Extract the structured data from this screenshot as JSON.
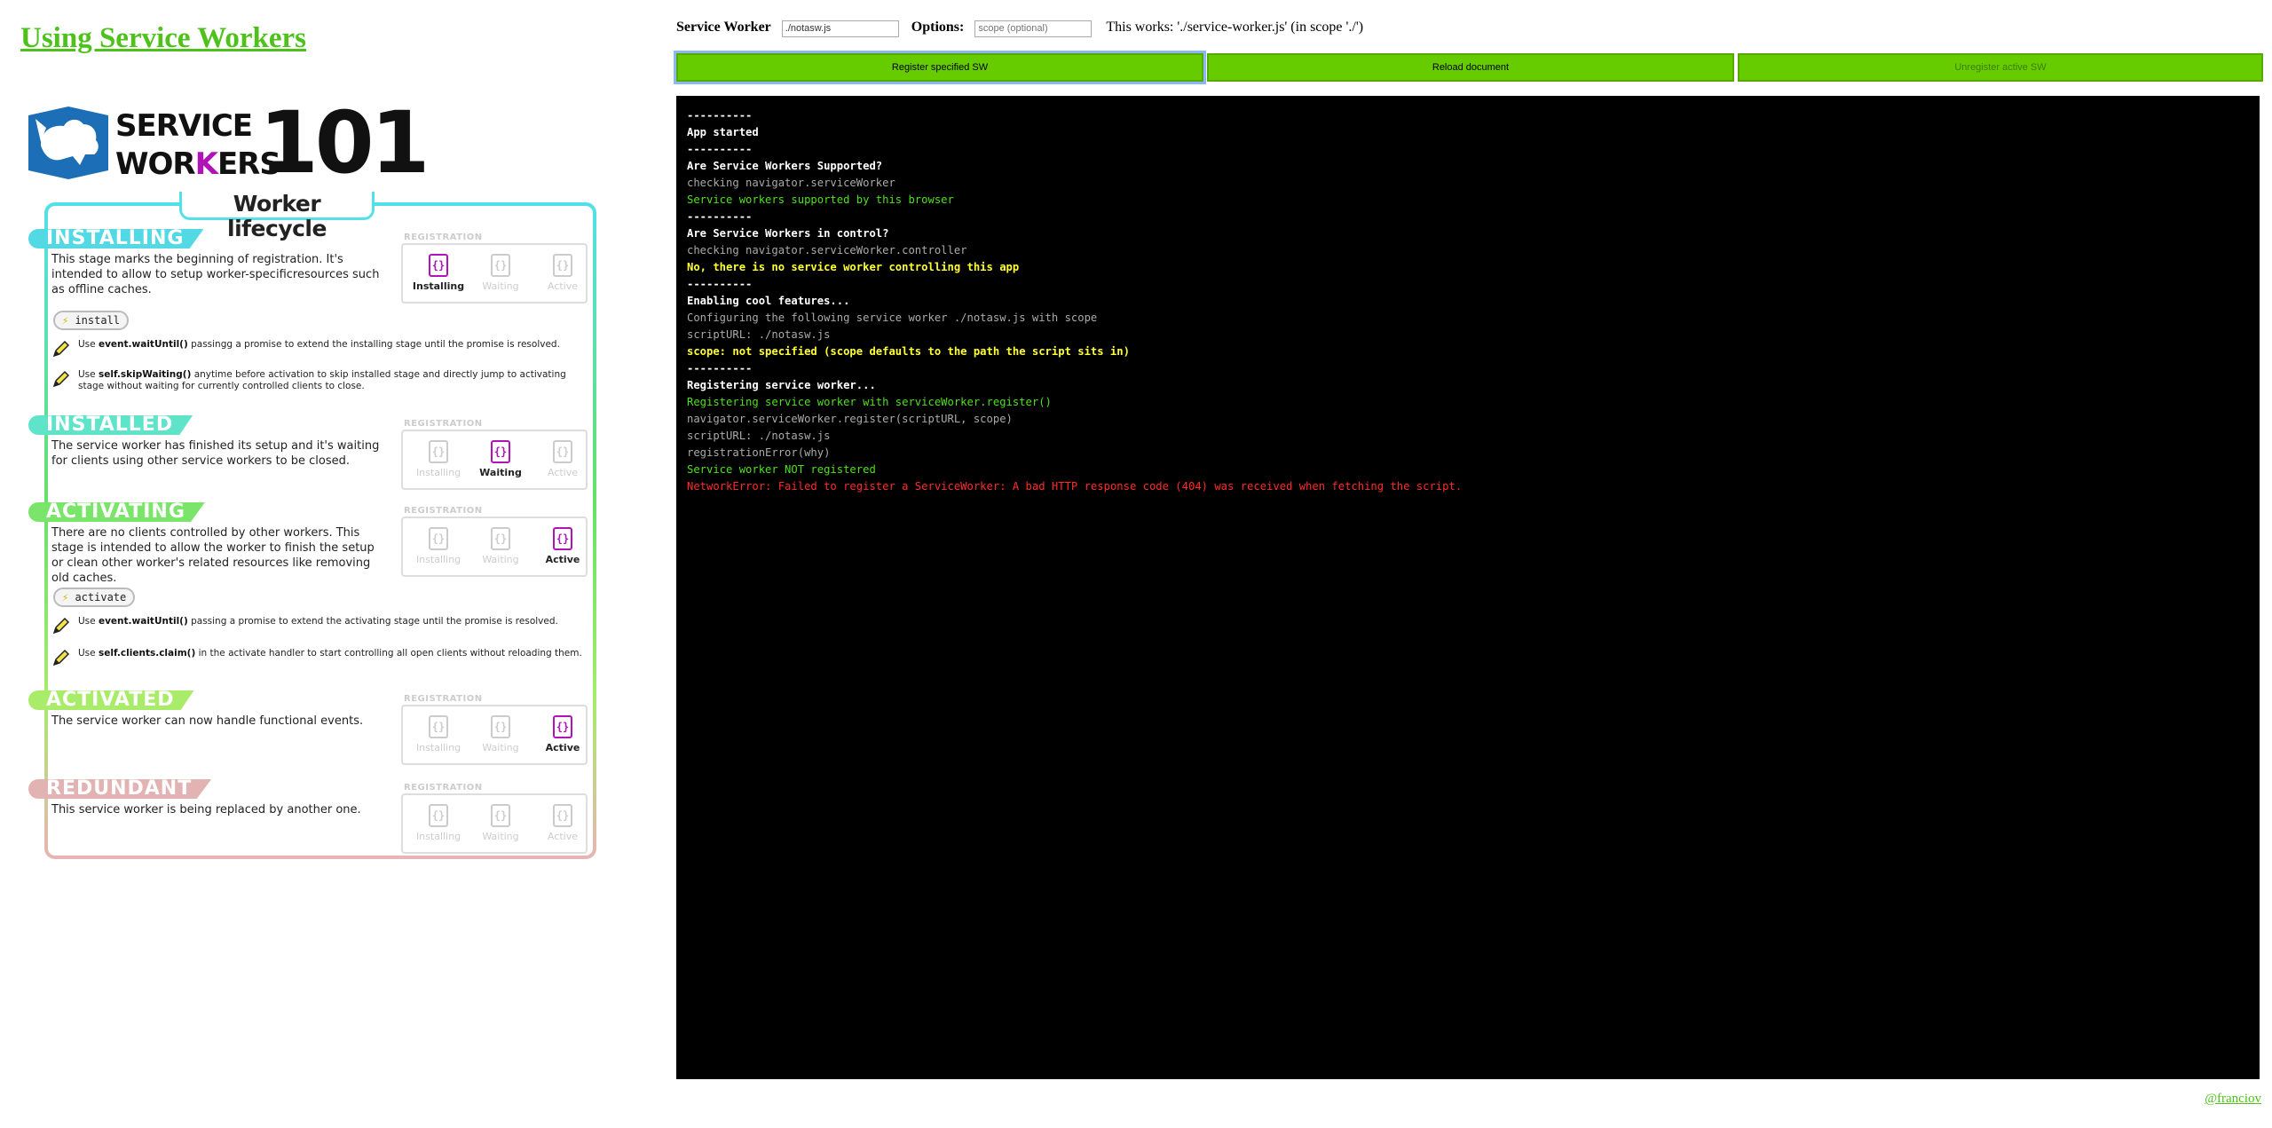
{
  "title": "Using Service Workers",
  "logo": {
    "word1": "SERVICE",
    "word2a": "WOR",
    "word2k": "K",
    "word2b": "ERS",
    "number": "101"
  },
  "lifecycle": {
    "heading": "Worker lifecycle",
    "registration_label": "REGISTRATION",
    "states": [
      "Installing",
      "Waiting",
      "Active"
    ],
    "sections": [
      {
        "badge": "INSTALLING",
        "color": "#52d9e4",
        "desc": "This stage marks the beginning of registration. It's intended to allow to setup worker-specificresources such as offline caches.",
        "active_state": 0,
        "event": "install",
        "tips": [
          {
            "code": "event.waitUntil()",
            "rest": " passingg a promise to extend the installing stage until the promise is resolved."
          },
          {
            "code": "self.skipWaiting()",
            "rest": " anytime before activation to skip installed stage and directly jump to activating stage without waiting for currently controlled clients to close."
          }
        ]
      },
      {
        "badge": "INSTALLED",
        "color": "#5fe3c9",
        "desc": "The service worker has finished its setup and it's waiting for clients using other service workers to be closed.",
        "active_state": 1
      },
      {
        "badge": "ACTIVATING",
        "color": "#7be46a",
        "desc": "There are no clients controlled by other workers. This stage is intended to allow the worker to finish the setup or clean other worker's related resources like removing old caches.",
        "active_state": 2,
        "event": "activate",
        "tips": [
          {
            "code": "event.waitUntil()",
            "rest": " passing a promise to extend the activating stage until the promise is resolved."
          },
          {
            "code": "self.clients.claim()",
            "rest": "  in the activate handler to start controlling all open clients without reloading them."
          }
        ]
      },
      {
        "badge": "ACTIVATED",
        "color": "#a8ec6a",
        "desc": "The service worker can now handle functional events.",
        "active_state": 2
      },
      {
        "badge": "REDUNDANT",
        "color": "#e3b2b2",
        "desc": "This service worker is being replaced by another one.",
        "active_state": -1
      }
    ],
    "use_word": "Use "
  },
  "toolbar": {
    "sw_label": "Service Worker",
    "sw_value": "./notasw.js",
    "options_label": "Options:",
    "scope_placeholder": "scope (optional)",
    "hint": "This works: './service-worker.js' (in scope './')"
  },
  "buttons": {
    "register": "Register specified SW",
    "reload": "Reload document",
    "unregister": "Unregister active SW"
  },
  "console": [
    {
      "t": "----------",
      "c": "white"
    },
    {
      "t": "App started",
      "c": "white"
    },
    {
      "t": "----------",
      "c": "white"
    },
    {
      "t": "Are Service Workers Supported?",
      "c": "white"
    },
    {
      "t": "checking navigator.serviceWorker",
      "c": "gray"
    },
    {
      "t": "Service workers supported by this browser",
      "c": "green"
    },
    {
      "t": "----------",
      "c": "white"
    },
    {
      "t": "Are Service Workers in control?",
      "c": "white"
    },
    {
      "t": "checking navigator.serviceWorker.controller",
      "c": "gray"
    },
    {
      "t": "No, there is no service worker controlling this app",
      "c": "yellow"
    },
    {
      "t": "----------",
      "c": "white"
    },
    {
      "t": "Enabling cool features...",
      "c": "white"
    },
    {
      "t": "Configuring the following service worker ./notasw.js with scope",
      "c": "gray"
    },
    {
      "t": "scriptURL: ./notasw.js",
      "c": "gray"
    },
    {
      "t": "scope: not specified (scope defaults to the path the script sits in)",
      "c": "yellow"
    },
    {
      "t": "----------",
      "c": "white"
    },
    {
      "t": "Registering service worker...",
      "c": "white"
    },
    {
      "t": "Registering service worker with serviceWorker.register()",
      "c": "green"
    },
    {
      "t": "navigator.serviceWorker.register(scriptURL, scope)",
      "c": "gray"
    },
    {
      "t": "scriptURL: ./notasw.js",
      "c": "gray"
    },
    {
      "t": "registrationError(why)",
      "c": "gray"
    },
    {
      "t": "Service worker NOT registered",
      "c": "green"
    },
    {
      "t": "NetworkError: Failed to register a ServiceWorker: A bad HTTP response code (404) was received when fetching the script.",
      "c": "red"
    }
  ],
  "credit": "@franciov",
  "colors": {
    "accent_green": "#66cc00",
    "link_green": "#4ec11a",
    "logo_blue": "#1c6fb6",
    "logo_purple": "#b013b8"
  }
}
